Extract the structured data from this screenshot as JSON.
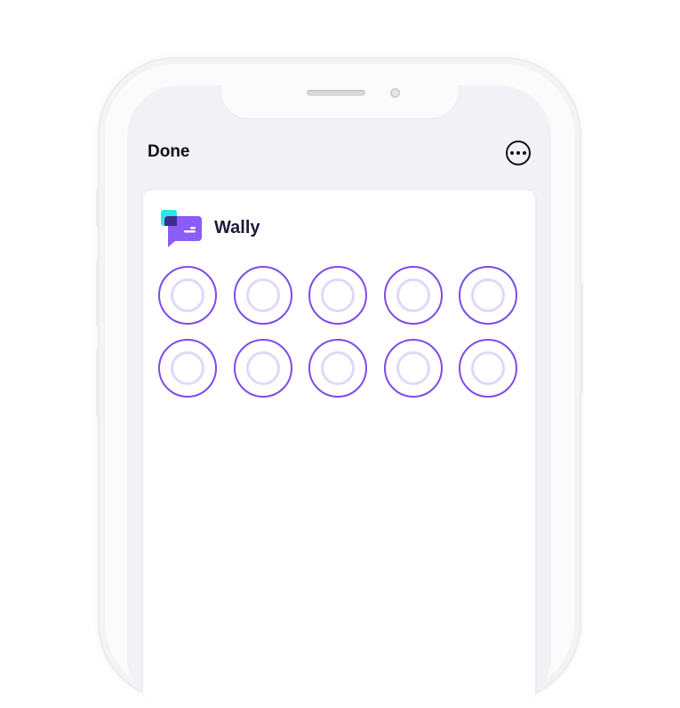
{
  "header": {
    "done_label": "Done",
    "more_icon": "ellipsis-circle-icon"
  },
  "app": {
    "name": "Wally",
    "logo_icon": "chat-bubbles-logo-icon"
  },
  "colors": {
    "accent": "#7c4ce8",
    "accent_light": "#e1d8f8",
    "logo_purple": "#8b5cf6",
    "logo_cyan": "#2ee6e6",
    "text_dark": "#1e1b3a"
  },
  "loaders": {
    "count": 10,
    "icon": "loading-placeholder-circle"
  }
}
